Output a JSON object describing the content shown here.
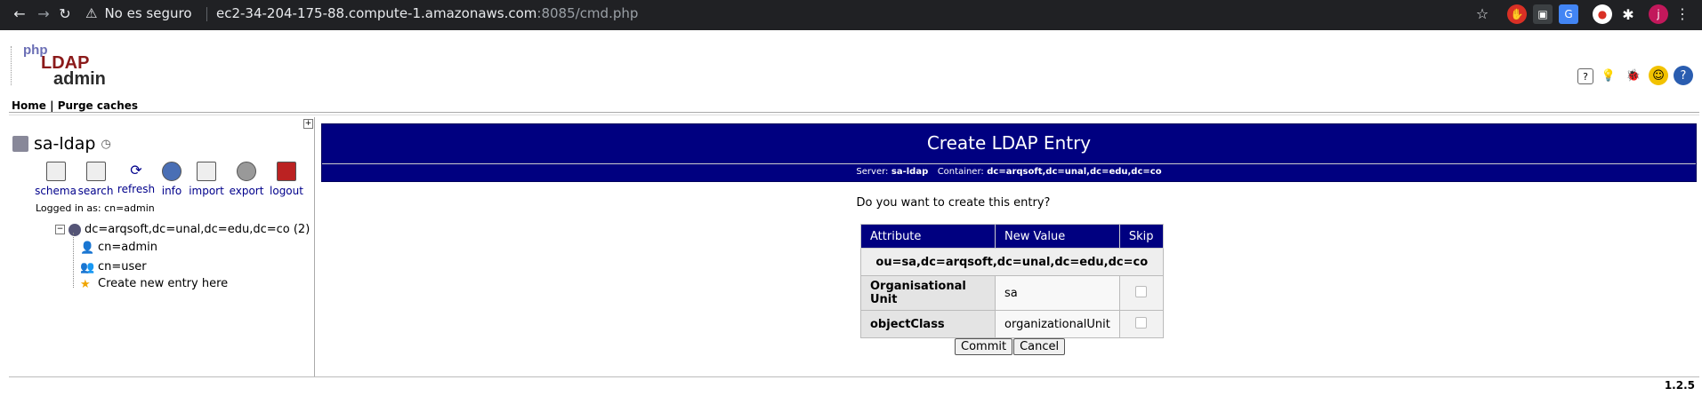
{
  "browser": {
    "security_label": "No es seguro",
    "url_main": "ec2-34-204-175-88.compute-1.amazonaws.com",
    "url_port_path": ":8085/cmd.php",
    "profile_initial": "j"
  },
  "logo": {
    "php": "php",
    "ldap": "LDAP",
    "admin": "admin"
  },
  "nav": {
    "home": "Home",
    "separator": "|",
    "purge": "Purge caches"
  },
  "tree": {
    "server_name": "sa-ldap",
    "tools": [
      {
        "label": "schema",
        "icon": "schema-icon"
      },
      {
        "label": "search",
        "icon": "search-icon"
      },
      {
        "label": "refresh",
        "icon": "refresh-icon"
      },
      {
        "label": "info",
        "icon": "info-icon"
      },
      {
        "label": "import",
        "icon": "import-icon"
      },
      {
        "label": "export",
        "icon": "export-icon"
      },
      {
        "label": "logout",
        "icon": "logout-icon"
      }
    ],
    "logged_in": "Logged in as: cn=admin",
    "base_dn": "dc=arqsoft,dc=unal,dc=edu,dc=co (2)",
    "children": [
      "cn=admin",
      "cn=user",
      "Create new entry here"
    ]
  },
  "main": {
    "title": "Create LDAP Entry",
    "server_label": "Server:",
    "server_value": "sa-ldap",
    "container_label": "Container:",
    "container_value": "dc=arqsoft,dc=unal,dc=edu,dc=co",
    "question": "Do you want to create this entry?",
    "table": {
      "headers": [
        "Attribute",
        "New Value",
        "Skip"
      ],
      "dn": "ou=sa,dc=arqsoft,dc=unal,dc=edu,dc=co",
      "rows": [
        {
          "attribute": "Organisational Unit",
          "value": "sa"
        },
        {
          "attribute": "objectClass",
          "value": "organizationalUnit"
        }
      ]
    },
    "commit": "Commit",
    "cancel": "Cancel"
  },
  "version": "1.2.5"
}
